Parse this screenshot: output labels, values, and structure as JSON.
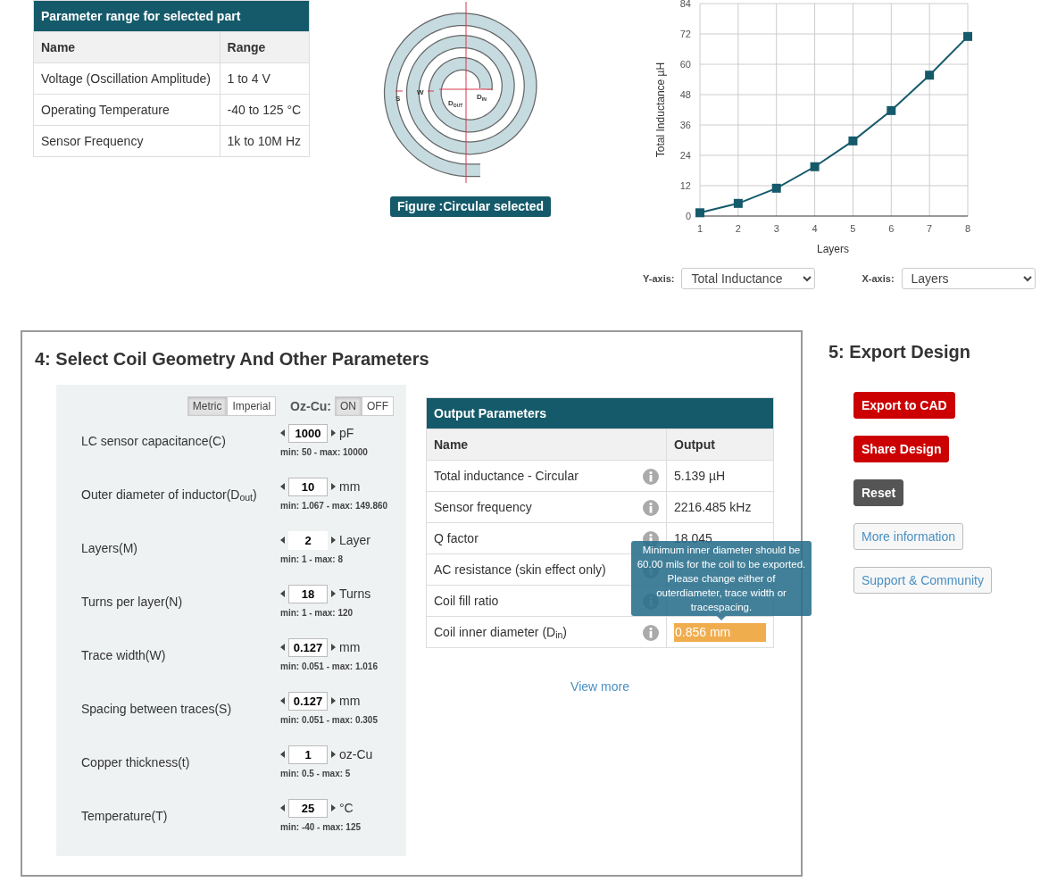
{
  "parameter_range": {
    "title": "Parameter range for selected part",
    "columns": [
      "Name",
      "Range"
    ],
    "rows": [
      [
        "Voltage (Oscillation Amplitude)",
        "1 to 4 V"
      ],
      [
        "Operating Temperature",
        "-40 to 125 °C"
      ],
      [
        "Sensor Frequency",
        "1k to 10M Hz"
      ]
    ]
  },
  "figure": {
    "labels": {
      "s": "S",
      "w": "W",
      "d_out": "D$_{OUT}$",
      "d_in": "D$_{IN}$"
    },
    "caption": "Figure :Circular selected"
  },
  "chart": {
    "chart_data": {
      "type": "line",
      "xlabel": "Layers",
      "ylabel": "Total Inductance µH",
      "x": [
        1,
        2,
        3,
        4,
        5,
        6,
        7,
        8
      ],
      "xlim": [
        1,
        8
      ],
      "ylim": [
        0,
        84
      ],
      "xticks": [
        1,
        2,
        3,
        4,
        5,
        6,
        7,
        8
      ],
      "yticks": [
        0,
        12,
        24,
        36,
        48,
        60,
        72,
        84
      ],
      "grid": true,
      "series": [
        {
          "color": "#155a6a",
          "marker": "square",
          "values": [
            1.3,
            5,
            11,
            19.5,
            29.7,
            41.7,
            55.7,
            71
          ]
        }
      ]
    },
    "y_axis": {
      "label": "Y-axis:",
      "value": "Total Inductance"
    },
    "x_axis": {
      "label": "X-axis:",
      "value": "Layers"
    }
  },
  "geometry": {
    "title": "4: Select Coil Geometry And Other Parameters",
    "units": [
      {
        "label": "Metric",
        "selected": true
      },
      {
        "label": "Imperial",
        "selected": false
      }
    ],
    "oz_cu": {
      "label": "Oz-Cu:",
      "options": [
        {
          "label": "ON",
          "selected": true
        },
        {
          "label": "OFF",
          "selected": false
        }
      ]
    },
    "parameters": [
      {
        "label": "LC sensor capacitance(C)",
        "value": "1000",
        "unit": "pF",
        "range": "min: 50 - max: 10000",
        "focused": false
      },
      {
        "label": "Outer diameter of inductor(D$_{out}$)",
        "value": "10",
        "unit": "mm",
        "range": "min: 1.067 - max: 149.860",
        "focused": false
      },
      {
        "label": "Layers(M)",
        "value": "2",
        "unit": "Layer",
        "range": "min: 1 - max: 8",
        "focused": true
      },
      {
        "label": "Turns per layer(N)",
        "value": "18",
        "unit": "Turns",
        "range": "min: 1 - max: 120",
        "focused": false
      },
      {
        "label": "Trace width(W)",
        "value": "0.127",
        "unit": "mm",
        "range": "min: 0.051 - max: 1.016",
        "focused": false
      },
      {
        "label": "Spacing between traces(S)",
        "value": "0.127",
        "unit": "mm",
        "range": "min: 0.051 - max: 0.305",
        "focused": false
      },
      {
        "label": "Copper thickness(t)",
        "value": "1",
        "unit": "oz-Cu",
        "range": "min: 0.5 - max: 5",
        "focused": false
      },
      {
        "label": "Temperature(T)",
        "value": "25",
        "unit": "°C",
        "range": "min: -40 - max: 125",
        "focused": false
      }
    ]
  },
  "output": {
    "title": "Output Parameters",
    "columns": [
      "Name",
      "Output"
    ],
    "rows": [
      {
        "name": "Total inductance - Circular",
        "value": "5.139 µH",
        "warning": false
      },
      {
        "name": "Sensor frequency",
        "value": "2216.485 kHz",
        "warning": false
      },
      {
        "name": "Q factor",
        "value": "18.045",
        "warning": false
      },
      {
        "name": "AC resistance (skin effect only)",
        "warning": false
      },
      {
        "name": "Coil fill ratio",
        "warning": false
      },
      {
        "name": "Coil inner diameter (D$_{in}$)",
        "value": "0.856 mm",
        "warning": true
      }
    ],
    "tooltip": "Minimum inner diameter should be 60.00 mils for the coil to be exported. Please change either of outerdiameter, trace width or tracespacing.",
    "view_more": "View more"
  },
  "export": {
    "title": "5: Export Design",
    "buttons": [
      {
        "label": "Export to CAD",
        "kind": "primary"
      },
      {
        "label": "Share Design",
        "kind": "primary"
      },
      {
        "label": "Reset",
        "kind": "dark"
      },
      {
        "label": "More information",
        "kind": "link"
      },
      {
        "label": "Support & Community",
        "kind": "link"
      }
    ]
  }
}
